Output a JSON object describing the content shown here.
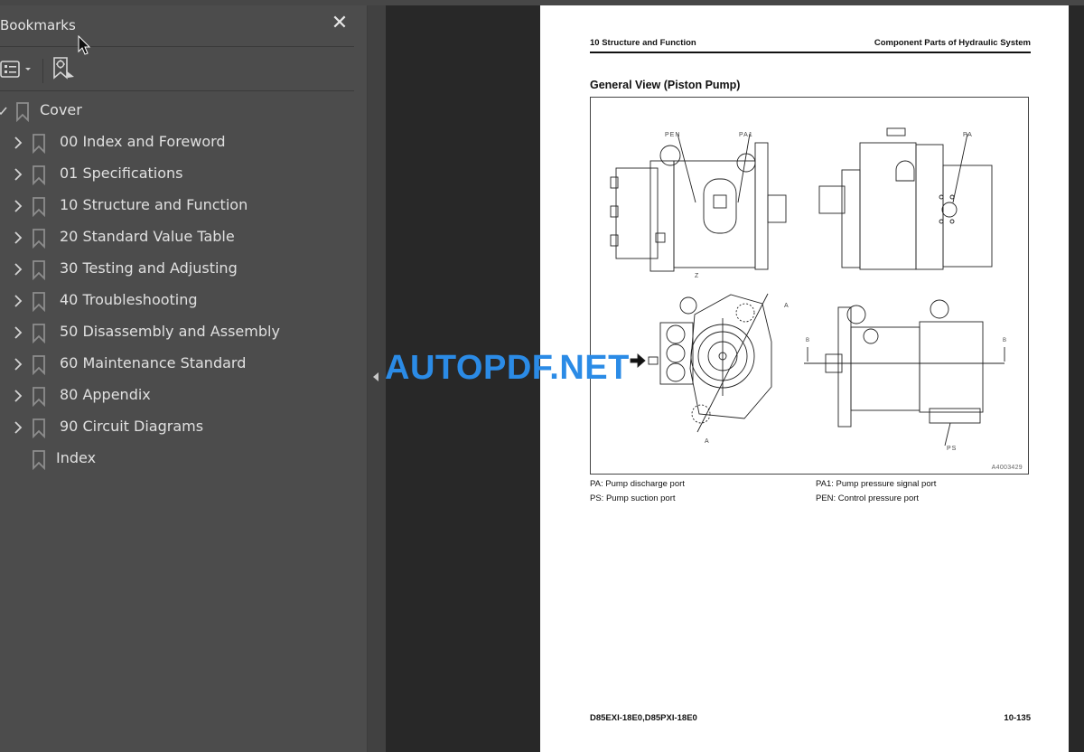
{
  "sidebar": {
    "title": "Bookmarks",
    "close_icon": "close-icon",
    "toolbar": {
      "options_icon": "list-options-icon",
      "find_icon": "find-current-bookmark-icon"
    },
    "items": [
      {
        "label": "Cover",
        "expander": "check",
        "expanded": true
      },
      {
        "label": "00 Index and Foreword",
        "expander": "chevron-right"
      },
      {
        "label": "01 Specifications",
        "expander": "chevron-right"
      },
      {
        "label": "10 Structure and Function",
        "expander": "chevron-right"
      },
      {
        "label": "20 Standard Value Table",
        "expander": "chevron-right"
      },
      {
        "label": "30 Testing and Adjusting",
        "expander": "chevron-right"
      },
      {
        "label": "40 Troubleshooting",
        "expander": "chevron-right"
      },
      {
        "label": "50 Disassembly and Assembly",
        "expander": "chevron-right"
      },
      {
        "label": "60 Maintenance Standard",
        "expander": "chevron-right"
      },
      {
        "label": "80 Appendix",
        "expander": "chevron-right"
      },
      {
        "label": "90 Circuit Diagrams",
        "expander": "chevron-right"
      },
      {
        "label": "Index",
        "expander": "none"
      }
    ]
  },
  "document": {
    "header_left": "10 Structure and Function",
    "header_right": "Component Parts of Hydraulic System",
    "section_title": "General View (Piston Pump)",
    "figure": {
      "labels": {
        "pen": "PEN",
        "pa1": "PA1",
        "pa": "PA",
        "ps": "PS",
        "z": "Z",
        "a": "A",
        "b": "B"
      },
      "code": "A4003429"
    },
    "legend": [
      {
        "text": "PA: Pump discharge port"
      },
      {
        "text": "PA1: Pump pressure signal port"
      },
      {
        "text": "PS: Pump suction port"
      },
      {
        "text": "PEN: Control pressure port"
      }
    ],
    "footer_left": "D85EXI-18E0,D85PXI-18E0",
    "footer_right": "10-135"
  },
  "watermark": {
    "text": "AUTOPDF.NET",
    "color": "#2b8be6"
  },
  "colors": {
    "sidebar_bg": "#4c4c4c",
    "workspace_bg": "#282828",
    "page_bg": "#ffffff"
  }
}
